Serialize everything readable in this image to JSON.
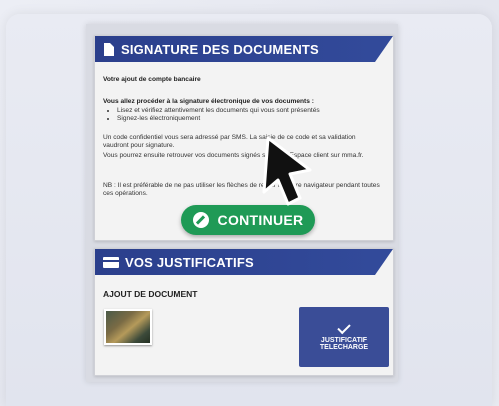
{
  "signature_panel": {
    "title": "SIGNATURE DES DOCUMENTS",
    "subtitle": "Votre ajout de compte bancaire",
    "intro": "Vous allez procéder à la signature électronique de vos documents :",
    "bullets": [
      "Lisez et vérifiez attentivement les documents qui vous sont présentés",
      "Signez-les électroniquement"
    ],
    "para1": "Un code confidentiel vous sera adressé par SMS. La saisie de ce code et sa validation vaudront pour signature.",
    "para2": "Vous pourrez ensuite retrouver vos documents signés sur votre Espace client sur mma.fr.",
    "note": "NB : Il est préférable de ne pas utiliser les flèches de retour de votre navigateur pendant toutes ces opérations.",
    "continue_label": "CONTINUER"
  },
  "justificatifs_panel": {
    "title": "VOS JUSTIFICATIFS",
    "section_label": "AJOUT DE DOCUMENT",
    "status_line1": "JUSTIFICATIF",
    "status_line2": "TELECHARGE"
  },
  "colors": {
    "header": "#2b3f8c",
    "continue": "#1f9a56",
    "status_button": "#3a4d97"
  },
  "icons": [
    "document-icon",
    "pencil-icon",
    "id-card-icon",
    "check-icon",
    "cursor-arrow-icon"
  ]
}
